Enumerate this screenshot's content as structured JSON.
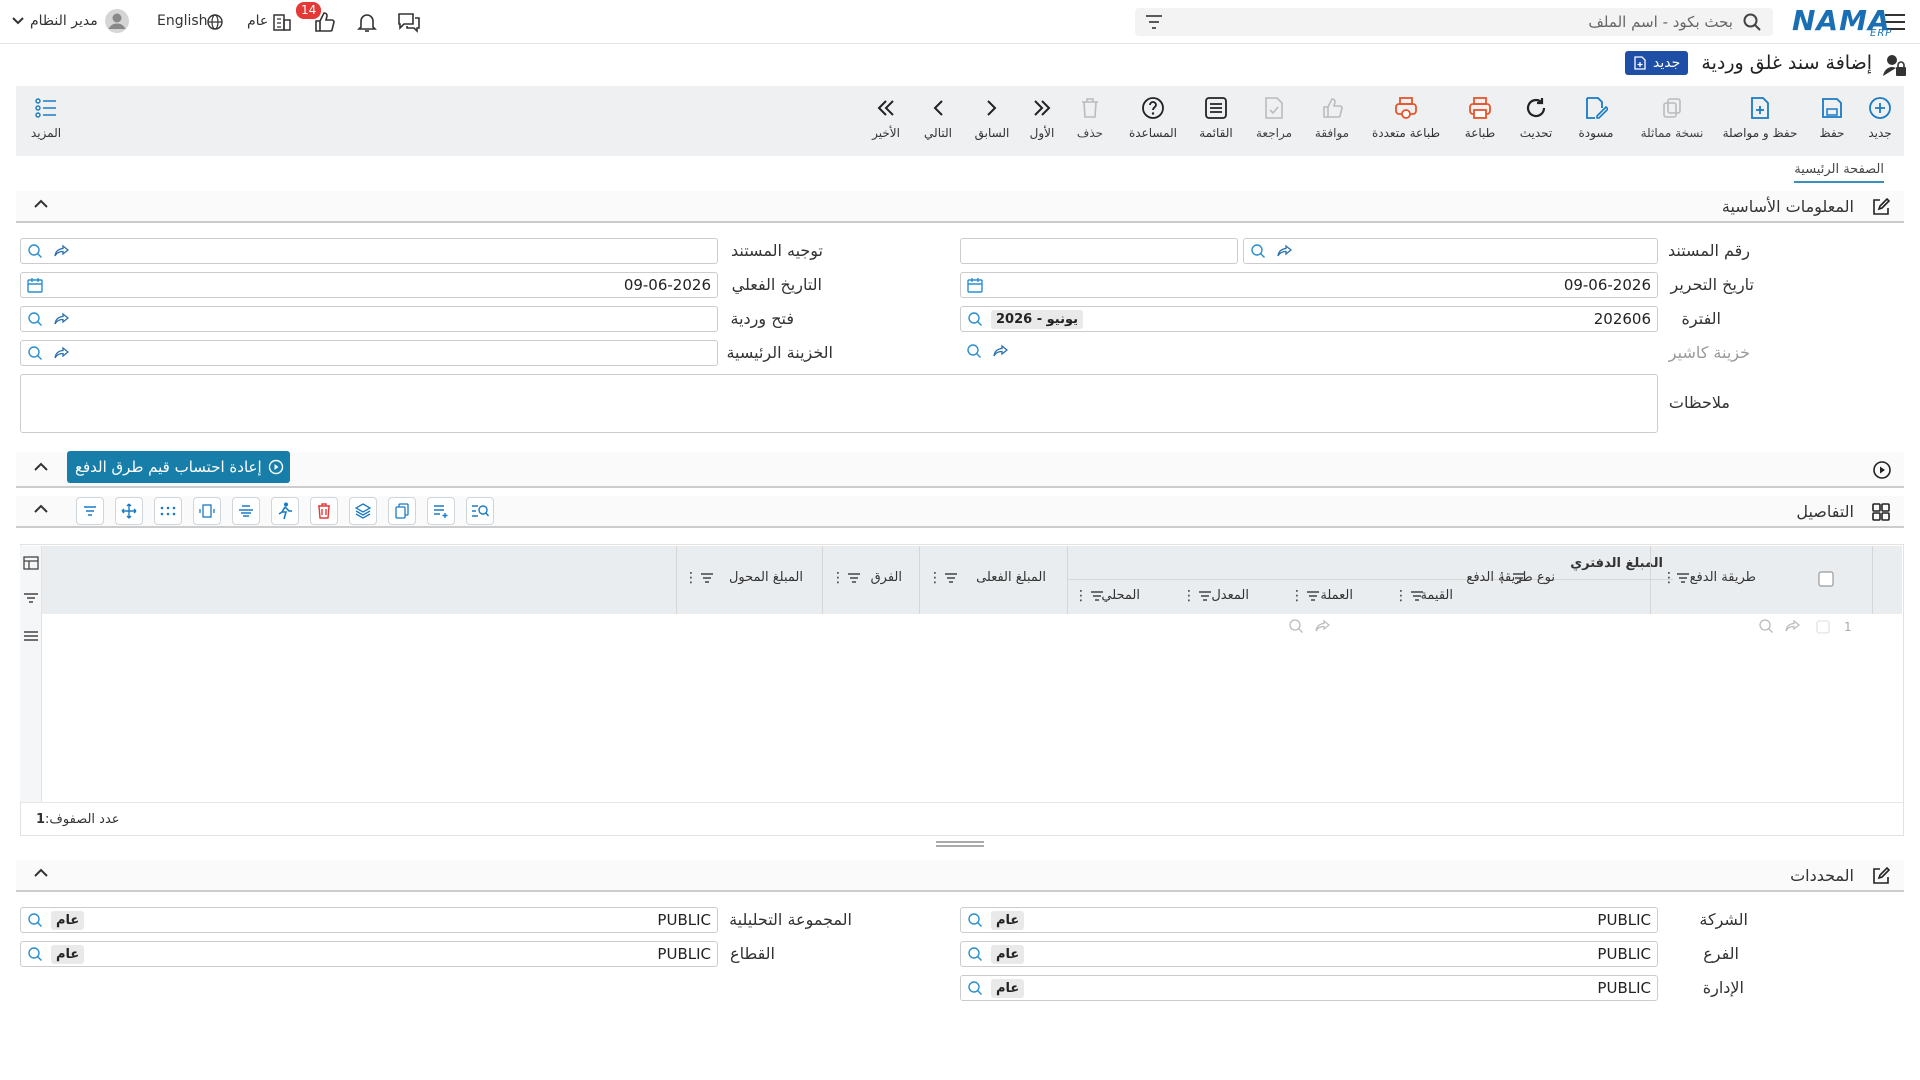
{
  "topbar": {
    "search_placeholder": "بحث بكود - اسم الملف",
    "logo_text": "NAMA",
    "logo_sub": "ERP",
    "user_name": "مدير النظام",
    "language": "English",
    "scope": "عام",
    "notification_count": "14"
  },
  "page": {
    "title": "إضافة سند غلق وردية",
    "new_badge": "جديد"
  },
  "toolbar": {
    "new": "جديد",
    "save": "حفظ",
    "save_continue": "حفظ و مواصلة",
    "duplicate": "نسخة مماثلة",
    "draft": "مسودة",
    "refresh": "تحديث",
    "print": "طباعة",
    "multi_print": "طباعة متعددة",
    "approve": "موافقة",
    "review": "مراجعة",
    "list": "القائمة",
    "help": "المساعدة",
    "delete": "حذف",
    "first": "الأول",
    "previous": "السابق",
    "next": "التالي",
    "last": "الأخير",
    "more": "المزيد"
  },
  "tabs": {
    "main": "الصفحة الرئيسية"
  },
  "basic_info": {
    "title": "المعلومات الأساسية",
    "doc_number_label": "رقم المستند",
    "doc_number_value": "",
    "doc_direction_label": "توجيه المستند",
    "doc_direction_value": "",
    "edit_date_label": "تاريخ التحرير",
    "edit_date_value": "09-06-2026",
    "actual_date_label": "التاريخ الفعلي",
    "actual_date_value": "09-06-2026",
    "period_label": "الفترة",
    "period_code": "202606",
    "period_name": "2026 - يونيو",
    "shift_open_label": "فتح وردية",
    "cashier_safe_label": "خزينة كاشير",
    "main_safe_label": "الخزينة الرئيسية",
    "notes_label": "ملاحظات"
  },
  "recalc": {
    "button": "إعادة احتساب قيم طرق الدفع"
  },
  "details": {
    "title": "التفاصيل",
    "columns": {
      "payment_method": "طريقة الدفع",
      "payment_method_type": "نوع طريقة الدفع",
      "book_amount_group": "المبلغ الدفتري",
      "value": "القيمة",
      "currency": "العملة",
      "rate": "المعدل",
      "local": "المحلي",
      "actual_amount": "المبلغ الفعلى",
      "difference": "الفرق",
      "transferred_amount": "المبلغ المحول"
    },
    "rows": [
      {
        "index": "1"
      }
    ],
    "row_count_label": "عدد الصفوف:",
    "row_count": "1"
  },
  "dimensions": {
    "title": "المحددات",
    "company_label": "الشركة",
    "company_value": "PUBLIC",
    "company_chip": "عام",
    "branch_label": "الفرع",
    "branch_value": "PUBLIC",
    "branch_chip": "عام",
    "department_label": "الإدارة",
    "department_value": "PUBLIC",
    "department_chip": "عام",
    "analytic_group_label": "المجموعة التحليلية",
    "analytic_group_value": "PUBLIC",
    "analytic_group_chip": "عام",
    "sector_label": "القطاع",
    "sector_value": "PUBLIC",
    "sector_chip": "عام"
  },
  "colors": {
    "accent": "#167ea8",
    "brand": "#1a6fb4",
    "badge_red": "#e53935",
    "new_badge": "#1f4ea6",
    "print_orange": "#e8542a"
  }
}
